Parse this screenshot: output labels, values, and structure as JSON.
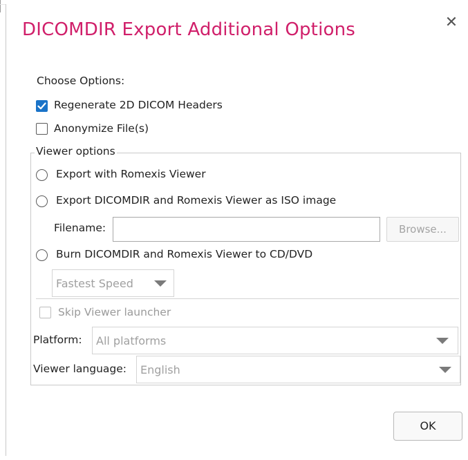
{
  "dialog": {
    "title": "DICOMDIR Export Additional Options",
    "close_glyph": "✕"
  },
  "options": {
    "heading": "Choose Options:",
    "regenerate": {
      "label": "Regenerate 2D DICOM Headers",
      "checked": true
    },
    "anonymize": {
      "label": "Anonymize File(s)",
      "checked": false
    }
  },
  "viewer": {
    "legend": "Viewer options",
    "radio_export": "Export with Romexis Viewer",
    "radio_iso": "Export DICOMDIR and Romexis Viewer as ISO image",
    "filename_label": "Filename:",
    "filename_value": "",
    "browse_label": "Browse...",
    "radio_burn": "Burn DICOMDIR and Romexis Viewer to CD/DVD",
    "speed_value": "Fastest Speed",
    "skip_launcher": "Skip Viewer launcher",
    "platform_label": "Platform:",
    "platform_value": "All platforms",
    "language_label": "Viewer language:",
    "language_value": "English"
  },
  "footer": {
    "ok_label": "OK"
  },
  "colors": {
    "title": "#d01f6a",
    "checkbox_checked": "#1a73c8"
  }
}
